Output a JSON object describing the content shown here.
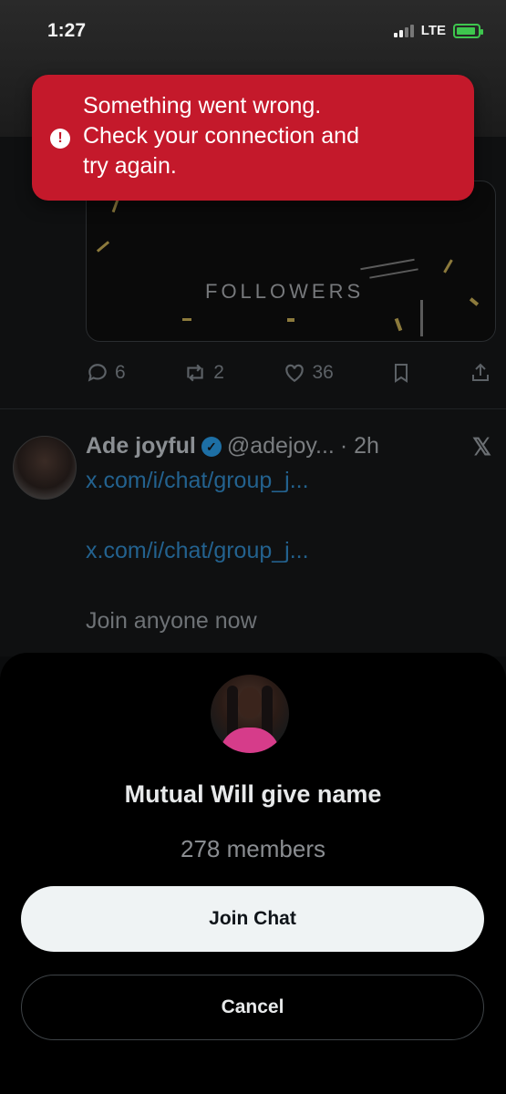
{
  "status_bar": {
    "time": "1:27",
    "network": "LTE"
  },
  "toast": {
    "message_line1": "Something went wrong.",
    "message_line2": "Check your connection and",
    "message_line3": "try again.",
    "icon": "exclamation-icon",
    "color": "#c4192b"
  },
  "media_card": {
    "text": "FOLLOWERS"
  },
  "actions": {
    "replies": "6",
    "reposts": "2",
    "likes": "36"
  },
  "post": {
    "name": "Ade joyful",
    "handle": "@adejoy...",
    "time": "· 2h",
    "link1": "x.com/i/chat/group_j...",
    "link2": "x.com/i/chat/group_j...",
    "body": "Join anyone now"
  },
  "sheet": {
    "title": "Mutual Will give name",
    "members": "278 members",
    "join_label": "Join Chat",
    "cancel_label": "Cancel"
  }
}
